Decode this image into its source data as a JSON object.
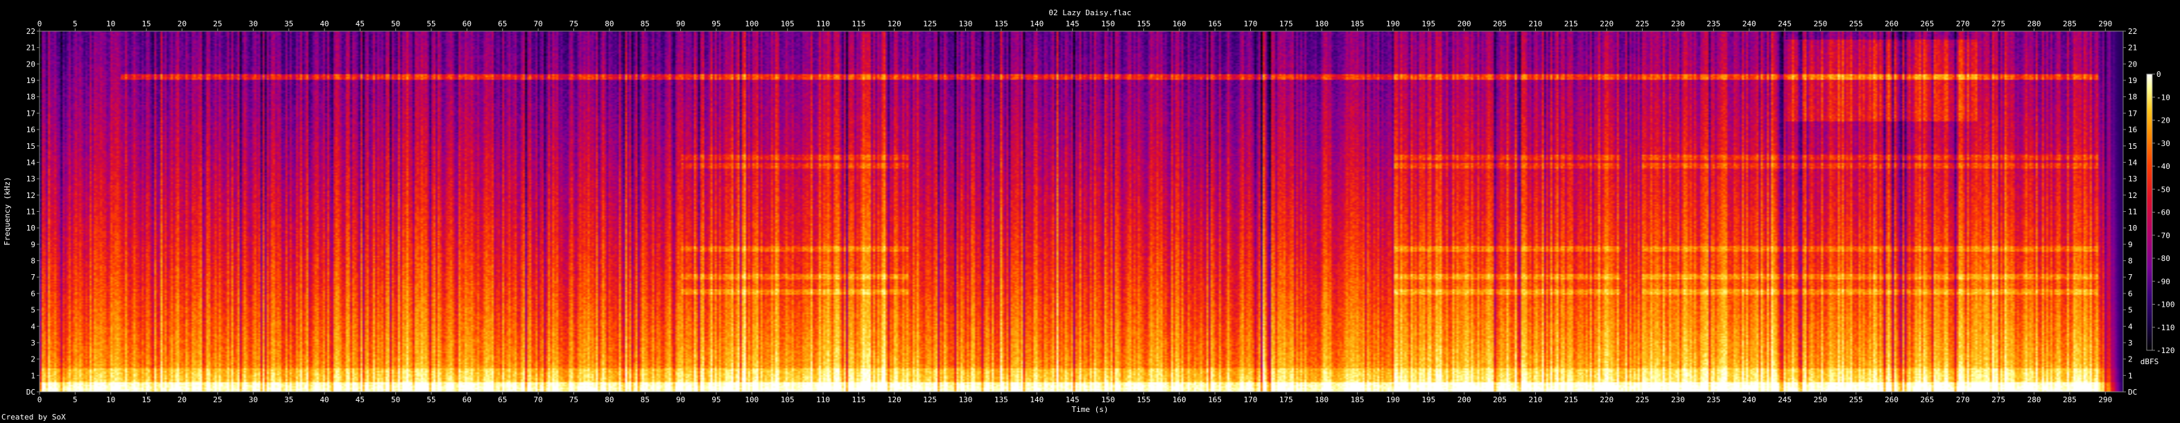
{
  "chart_data": {
    "type": "heatmap",
    "title": "02 Lazy Daisy.flac",
    "xlabel": "Time (s)",
    "ylabel": "Frequency (kHz)",
    "xlim": [
      0,
      292.5
    ],
    "ylim": [
      0,
      22
    ],
    "x_ticks": [
      0,
      5,
      10,
      15,
      20,
      25,
      30,
      35,
      40,
      45,
      50,
      55,
      60,
      65,
      70,
      75,
      80,
      85,
      90,
      95,
      100,
      105,
      110,
      115,
      120,
      125,
      130,
      135,
      140,
      145,
      150,
      155,
      160,
      165,
      170,
      175,
      180,
      185,
      190,
      195,
      200,
      205,
      210,
      215,
      220,
      225,
      230,
      235,
      240,
      245,
      250,
      255,
      260,
      265,
      270,
      275,
      280,
      285,
      290
    ],
    "y_ticks": [
      "DC",
      "1",
      "2",
      "3",
      "4",
      "5",
      "6",
      "7",
      "8",
      "9",
      "10",
      "11",
      "12",
      "13",
      "14",
      "15",
      "16",
      "17",
      "18",
      "19",
      "20",
      "21",
      "22"
    ],
    "colorbar": {
      "label": "dBFS",
      "ticks": [
        0,
        -10,
        -20,
        -30,
        -40,
        -50,
        -60,
        -70,
        -80,
        -90,
        -100,
        -110,
        -120
      ],
      "range": [
        -120,
        0
      ]
    },
    "colormap": [
      "#000000",
      "#1a004a",
      "#3b007a",
      "#7a0096",
      "#b4006e",
      "#e0102a",
      "#ff4000",
      "#ff8c00",
      "#ffc81e",
      "#ffff96",
      "#ffffff"
    ],
    "features": {
      "tone_19khz": {
        "freq_khz": 19.2,
        "start_s": 11.5,
        "end_s": 289,
        "level_db": -60
      },
      "high_block": {
        "freq_range_khz": [
          16.5,
          21.5
        ],
        "start_s": 245,
        "end_s": 272,
        "level_db": -78
      },
      "louder_sections": [
        [
          90,
          122
        ],
        [
          190,
          222
        ],
        [
          225,
          289
        ]
      ],
      "fade_out_s": [
        289,
        292.5
      ],
      "banding_khz": [
        8.7,
        7.0,
        6.1,
        13.8,
        14.3
      ]
    }
  },
  "footer": {
    "credit": "Created by SoX"
  }
}
